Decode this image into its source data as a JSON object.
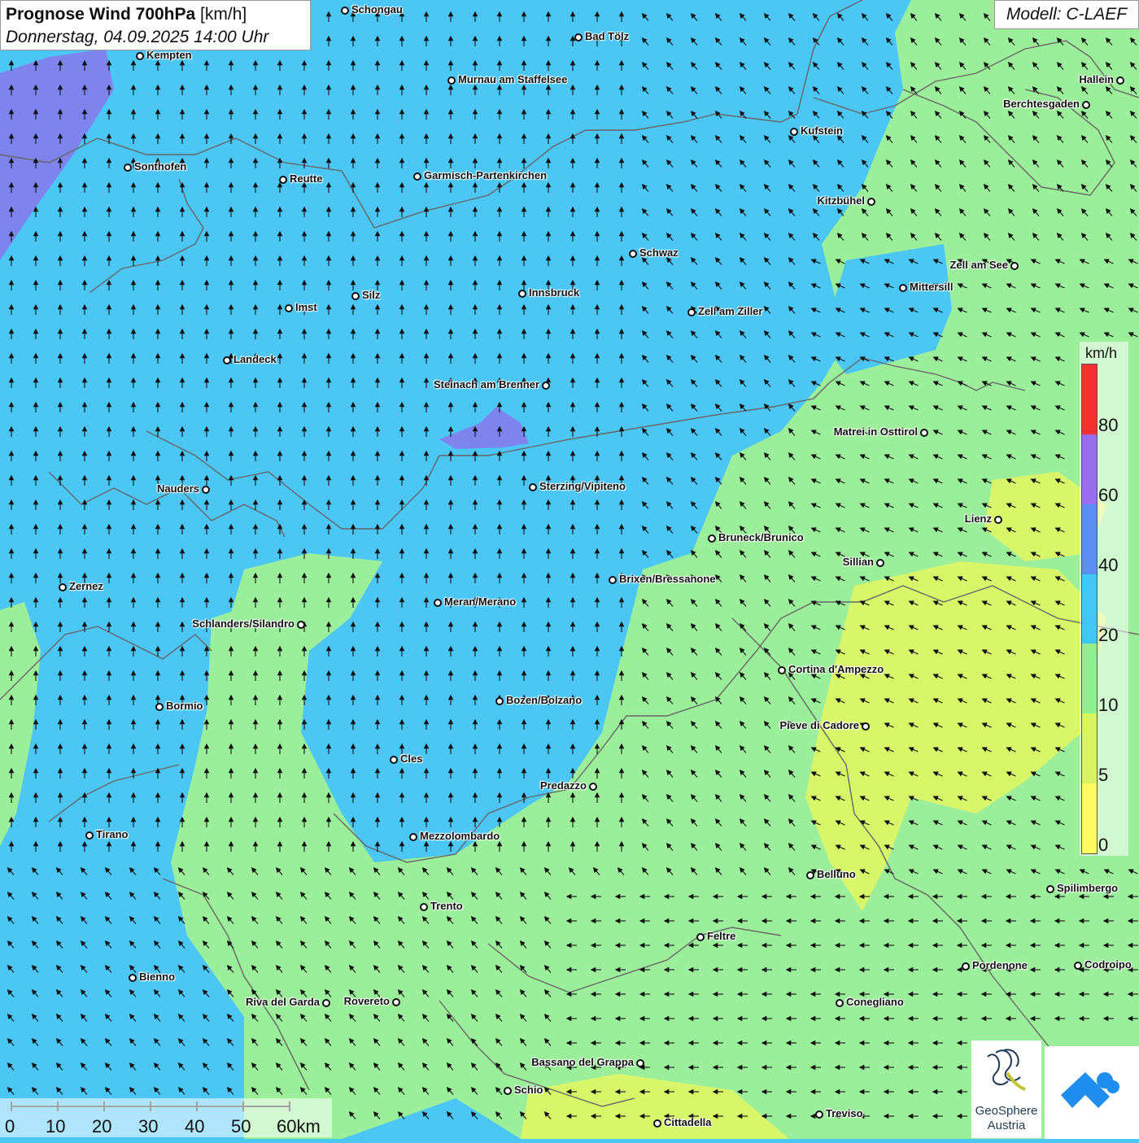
{
  "header": {
    "title_bold": "Prognose Wind 700hPa",
    "title_unit": "[km/h]",
    "subtitle": "Donnerstag, 04.09.2025 14:00 Uhr",
    "model": "Modell: C-LAEF"
  },
  "legend": {
    "unit": "km/h",
    "classes": [
      {
        "label": "0",
        "color": "#fffb60"
      },
      {
        "label": "5",
        "color": "#d8f560"
      },
      {
        "label": "10",
        "color": "#8ef08e"
      },
      {
        "label": "20",
        "color": "#3fc8f5"
      },
      {
        "label": "40",
        "color": "#5a8ef5"
      },
      {
        "label": "60",
        "color": "#9a6cf0"
      },
      {
        "label": "80",
        "color": "#f53030"
      }
    ]
  },
  "scale_bar": {
    "labels": [
      "0",
      "10",
      "20",
      "30",
      "40",
      "50",
      "60km"
    ]
  },
  "logos": {
    "geosphere_line1": "GeoSphere",
    "geosphere_line2": "Austria"
  },
  "places": [
    {
      "name": "Schongau"
    },
    {
      "name": "Bad Tölz"
    },
    {
      "name": "Kempten"
    },
    {
      "name": "Murnau am Staffelsee"
    },
    {
      "name": "Hallein"
    },
    {
      "name": "Berchtesgaden"
    },
    {
      "name": "Kufstein"
    },
    {
      "name": "Sonthofen"
    },
    {
      "name": "Reutte"
    },
    {
      "name": "Garmisch-Partenkirchen"
    },
    {
      "name": "Kitzbühel"
    },
    {
      "name": "Schwaz"
    },
    {
      "name": "Zell am See"
    },
    {
      "name": "Mittersill"
    },
    {
      "name": "Innsbruck"
    },
    {
      "name": "Silz"
    },
    {
      "name": "Imst"
    },
    {
      "name": "Zell am Ziller"
    },
    {
      "name": "Landeck"
    },
    {
      "name": "Steinach am Brenner"
    },
    {
      "name": "Matrei in Osttirol"
    },
    {
      "name": "Nauders"
    },
    {
      "name": "Sterzing/Vipiteno"
    },
    {
      "name": "Lienz"
    },
    {
      "name": "Bruneck/Brunico"
    },
    {
      "name": "Sillian"
    },
    {
      "name": "Zernez"
    },
    {
      "name": "Brixen/Bressanone"
    },
    {
      "name": "Meran/Merano"
    },
    {
      "name": "Schlanders/Silandro"
    },
    {
      "name": "Cortina d'Ampezzo"
    },
    {
      "name": "Bormio"
    },
    {
      "name": "Bozen/Bolzano"
    },
    {
      "name": "Pieve di Cadore"
    },
    {
      "name": "Cles"
    },
    {
      "name": "Predazzo"
    },
    {
      "name": "Tirano"
    },
    {
      "name": "Mezzolombardo"
    },
    {
      "name": "Belluno"
    },
    {
      "name": "Spilimbergo"
    },
    {
      "name": "Trento"
    },
    {
      "name": "Feltre"
    },
    {
      "name": "Pordenone"
    },
    {
      "name": "Codroipo"
    },
    {
      "name": "Bienno"
    },
    {
      "name": "Riva del Garda"
    },
    {
      "name": "Rovereto"
    },
    {
      "name": "Conegliano"
    },
    {
      "name": "Bassano del Grappa"
    },
    {
      "name": "Schio"
    },
    {
      "name": "Treviso"
    },
    {
      "name": "Cittadella"
    }
  ]
}
